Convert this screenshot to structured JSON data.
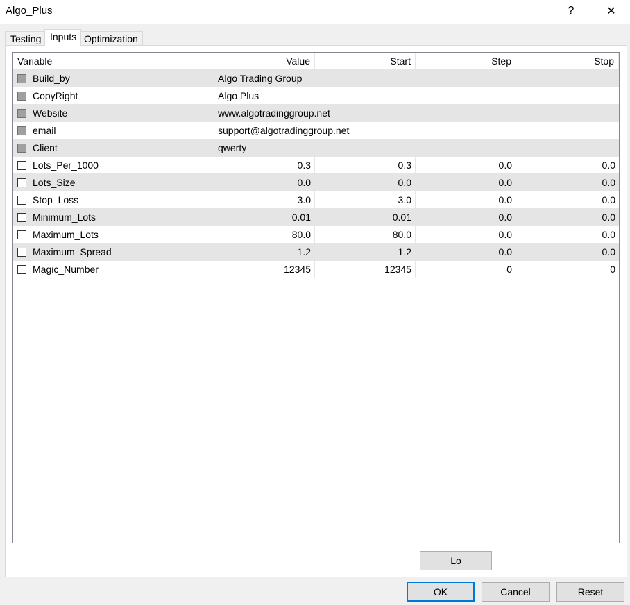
{
  "window": {
    "title": "Algo_Plus",
    "help_glyph": "?",
    "close_glyph": "✕"
  },
  "tabs": [
    {
      "label": "Testing",
      "active": false
    },
    {
      "label": "Inputs",
      "active": true
    },
    {
      "label": "Optimization",
      "active": false
    }
  ],
  "columns": {
    "variable": "Variable",
    "value": "Value",
    "start": "Start",
    "step": "Step",
    "stop": "Stop"
  },
  "rows": [
    {
      "variable": "Build_by",
      "value": "Algo Trading Group",
      "text_only": true
    },
    {
      "variable": "CopyRight",
      "value": "Algo Plus",
      "text_only": true
    },
    {
      "variable": "Website",
      "value": "www.algotradinggroup.net",
      "text_only": true
    },
    {
      "variable": "email",
      "value": "support@algotradinggroup.net",
      "text_only": true
    },
    {
      "variable": "Client",
      "value": "qwerty",
      "text_only": true
    },
    {
      "variable": "Lots_Per_1000",
      "value": "0.3",
      "start": "0.3",
      "step": "0.0",
      "stop": "0.0"
    },
    {
      "variable": "Lots_Size",
      "value": "0.0",
      "start": "0.0",
      "step": "0.0",
      "stop": "0.0"
    },
    {
      "variable": "Stop_Loss",
      "value": "3.0",
      "start": "3.0",
      "step": "0.0",
      "stop": "0.0"
    },
    {
      "variable": "Minimum_Lots",
      "value": "0.01",
      "start": "0.01",
      "step": "0.0",
      "stop": "0.0"
    },
    {
      "variable": "Maximum_Lots",
      "value": "80.0",
      "start": "80.0",
      "step": "0.0",
      "stop": "0.0"
    },
    {
      "variable": "Maximum_Spread",
      "value": "1.2",
      "start": "1.2",
      "step": "0.0",
      "stop": "0.0"
    },
    {
      "variable": "Magic_Number",
      "value": "12345",
      "start": "12345",
      "step": "0",
      "stop": "0"
    }
  ],
  "buttons": {
    "load": "Lo",
    "ok": "OK",
    "cancel": "Cancel",
    "reset": "Reset"
  }
}
